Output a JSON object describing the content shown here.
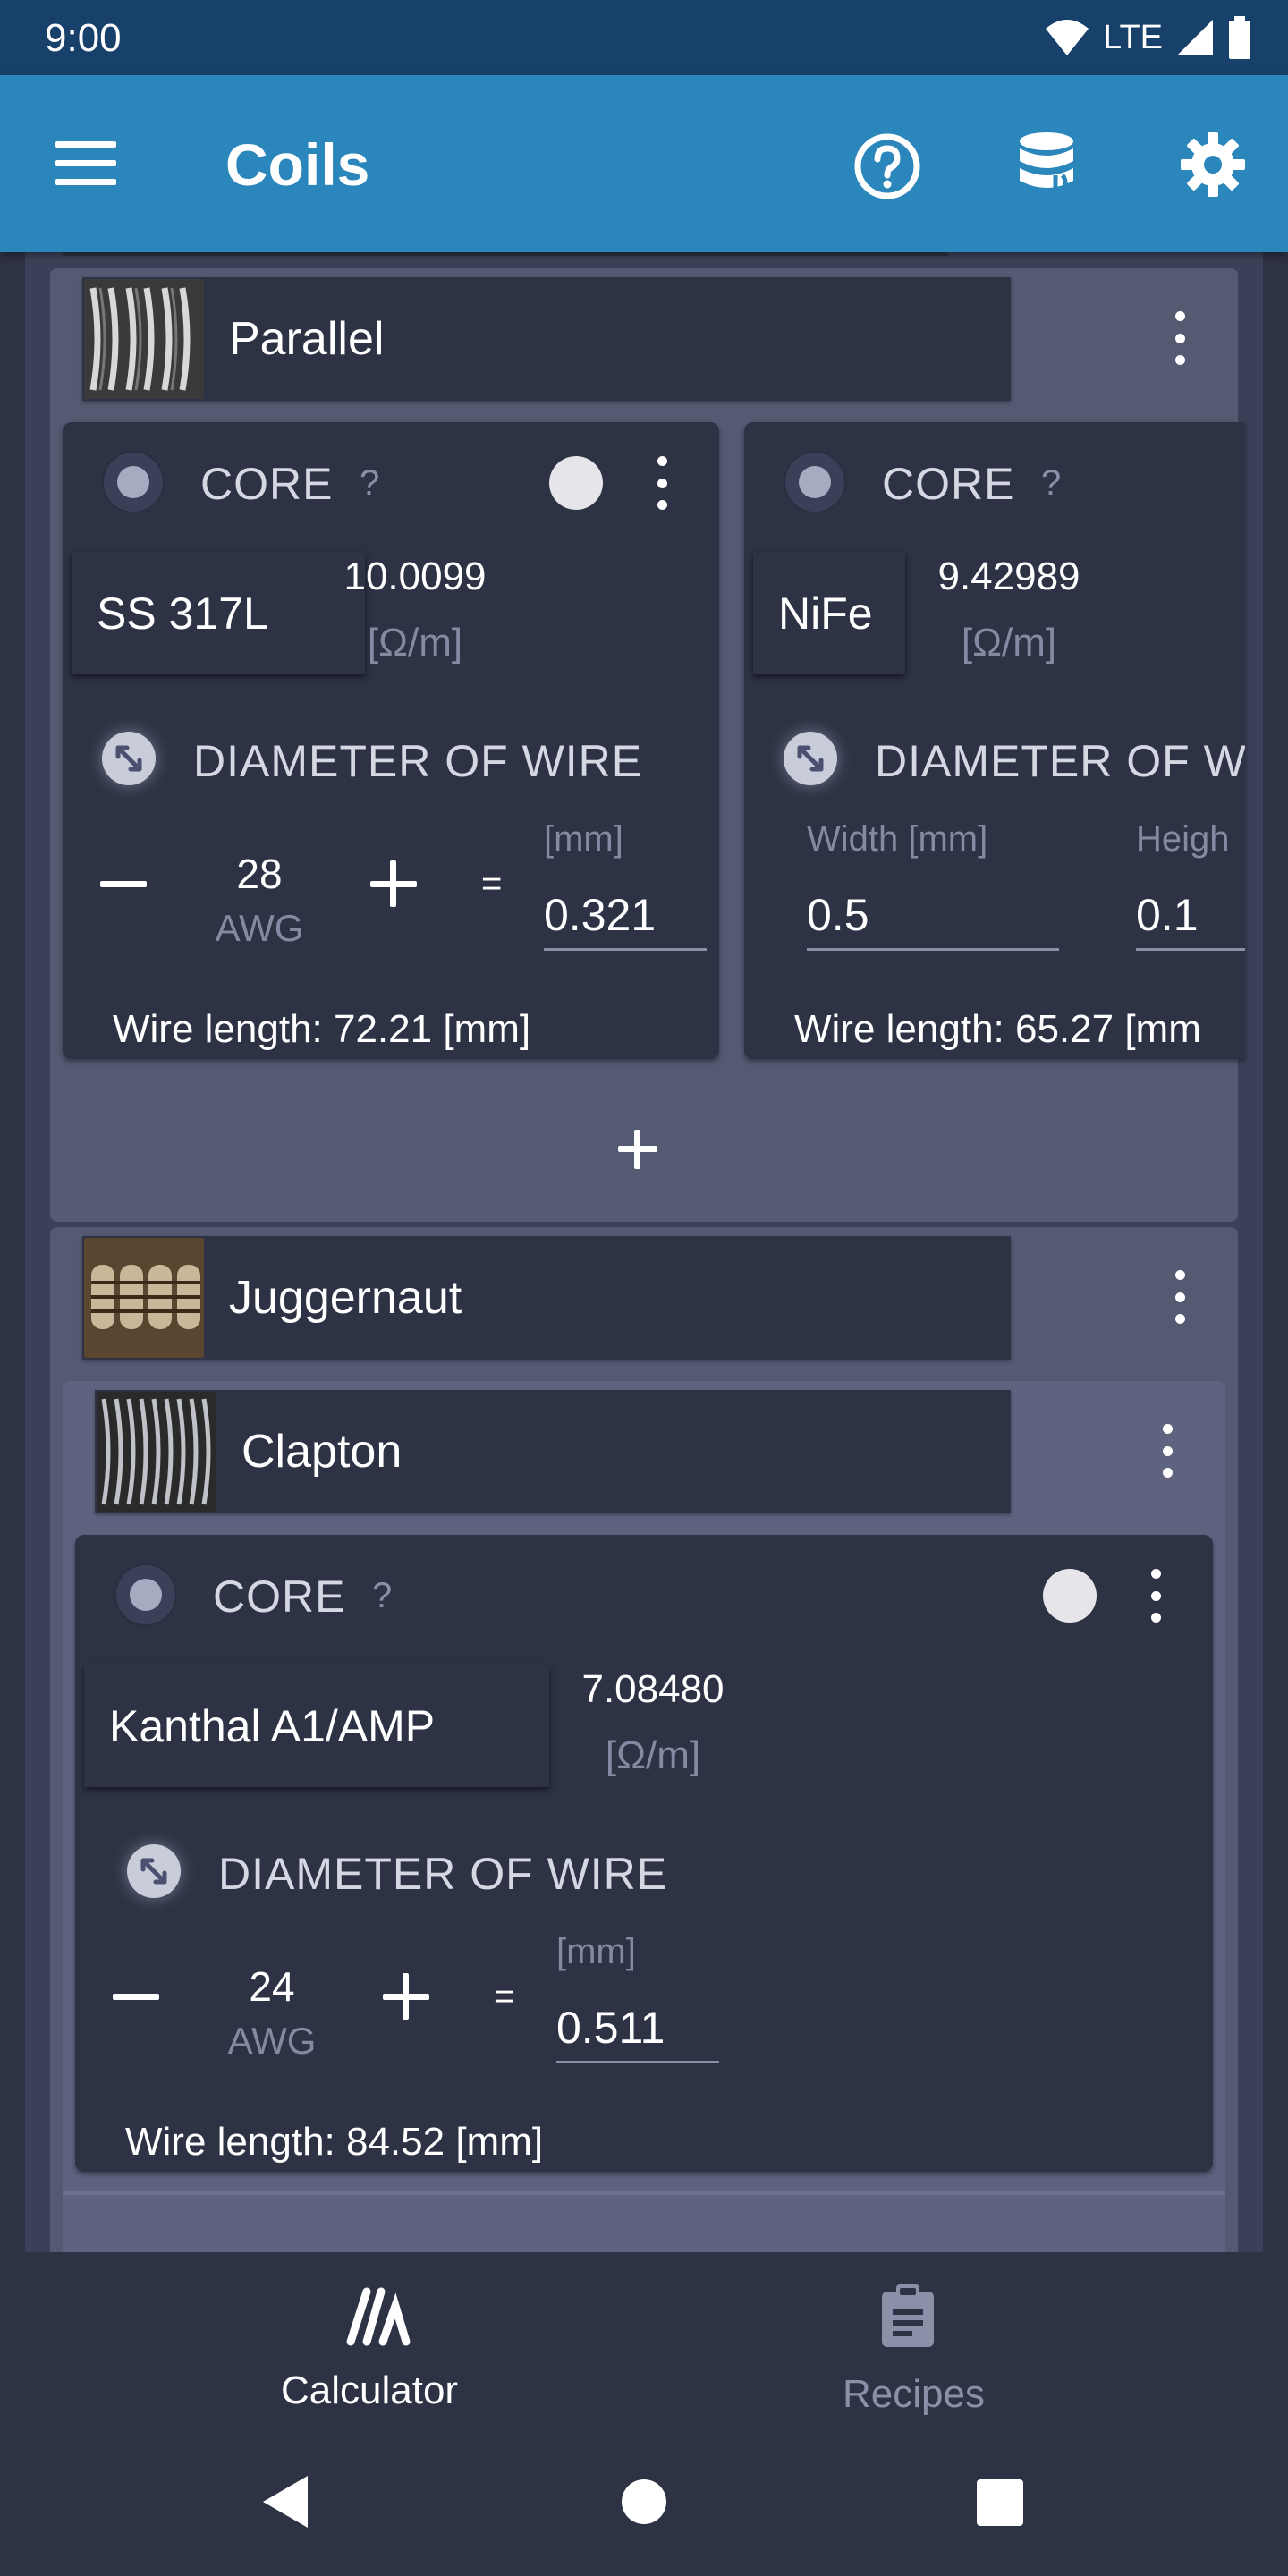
{
  "status_bar": {
    "time": "9:00",
    "network": "LTE"
  },
  "app_bar": {
    "title": "Coils",
    "icons": [
      "menu-icon",
      "help-icon",
      "database-icon",
      "gear-icon"
    ]
  },
  "groups": [
    {
      "name": "Parallel",
      "wires": [
        {
          "core_label": "CORE",
          "help": "?",
          "material": "SS 317L",
          "resistance": "10.0099",
          "resistance_unit": "[Ω/m]",
          "diameter_label": "DIAMETER OF WIRE",
          "awg": "28",
          "awg_unit": "AWG",
          "equals": "=",
          "mm_unit": "[mm]",
          "diameter_value": "0.321",
          "wire_length": "Wire length: 72.21 [mm]"
        },
        {
          "core_label": "CORE",
          "help": "?",
          "material": "NiFe",
          "resistance": "9.42989",
          "resistance_unit": "[Ω/m]",
          "diameter_label": "DIAMETER OF W",
          "width_label": "Width [mm]",
          "width_value": "0.5",
          "height_label": "Heigh",
          "height_value": "0.1",
          "wire_length": "Wire length: 65.27 [mm"
        }
      ]
    },
    {
      "name": "Juggernaut",
      "subgroup": {
        "name": "Clapton",
        "wire": {
          "core_label": "CORE",
          "help": "?",
          "material": "Kanthal A1/AMP",
          "resistance": "7.08480",
          "resistance_unit": "[Ω/m]",
          "diameter_label": "DIAMETER OF WIRE",
          "awg": "24",
          "awg_unit": "AWG",
          "equals": "=",
          "mm_unit": "[mm]",
          "diameter_value": "0.511",
          "wire_length": "Wire length: 84.52 [mm]"
        }
      }
    }
  ],
  "bottom_nav": {
    "items": [
      {
        "label": "Calculator",
        "icon": "calculator-icon",
        "active": true
      },
      {
        "label": "Recipes",
        "icon": "clipboard-icon",
        "active": false
      }
    ]
  },
  "colors": {
    "app_bar": "#2a86bb",
    "status_bar": "#17406a",
    "card": "#2d3244",
    "background": "#3b4058"
  }
}
